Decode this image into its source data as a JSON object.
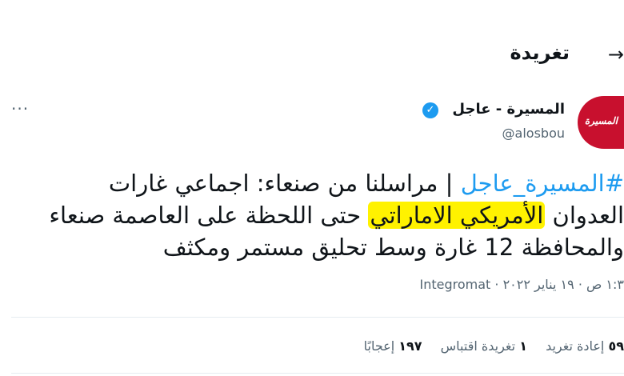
{
  "header": {
    "title": "تغريدة",
    "back_icon": "arrow-right-icon"
  },
  "author": {
    "name": "المسيرة - عاجل",
    "handle": "@alosbou",
    "avatar_text": "المسيرة",
    "verified_icon": "verified-badge-icon"
  },
  "tweet": {
    "line1_hashtag": "#المسيرة_عاجل",
    "line1_rest": " | مراسلنا من صنعاء: اجماعي غارات",
    "line2_pre": "العدوان ",
    "line2_highlight": "الأمريكي الاماراتي",
    "line2_post": " حتى اللحظة على العاصمة صنعاء",
    "line3": "والمحافظة 12 غارة وسط تحليق مستمر ومكثف"
  },
  "meta": "١:٣ ص · ١٩ يناير ٢٠٢٢ · Integromat",
  "stats": {
    "retweets_count": "٥٩",
    "retweets_label": "إعادة تغريد",
    "quotes_count": "١",
    "quotes_label": "تغريدة اقتباس",
    "likes_count": "١٩٧",
    "likes_label": "إعجابًا"
  },
  "colors": {
    "accent": "#1d9bf0",
    "highlight": "#fff200",
    "avatar_bg": "#c8102e"
  }
}
